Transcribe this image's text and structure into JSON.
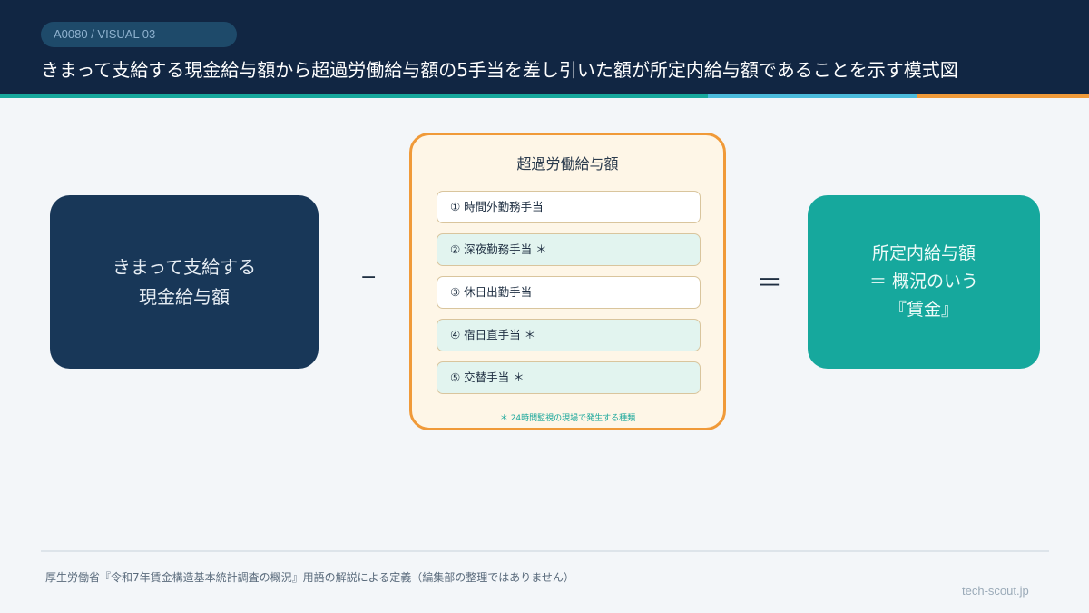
{
  "header": {
    "badge": "A0080 / VISUAL 03",
    "title": "きまって支給する現金給与額から超過労働給与額の5手当を差し引いた額が所定内給与額であることを示す模式図",
    "accent_colors": [
      "#17a89c",
      "#4bbbdc",
      "#f09a39"
    ]
  },
  "left_box": {
    "line1": "きまって支給する",
    "line2": "現金給与額",
    "color": "#183758"
  },
  "operators": {
    "minus": "−",
    "equals": "＝"
  },
  "center_box": {
    "title": "超過労働給与額",
    "allowances": [
      "① 時間外勤務手当",
      "② 深夜勤務手当 ＊",
      "③ 休日出勤手当",
      "④ 宿日直手当 ＊",
      "⑤ 交替手当 ＊"
    ],
    "note": "＊ 24時間監視の現場で発生する種類",
    "border_color": "#f09a39"
  },
  "right_box": {
    "line1": "所定内給与額",
    "line2": "＝ 概況のいう",
    "line3": "『賃金』",
    "color": "#16a89d"
  },
  "footer": {
    "source": "厚生労働省『令和7年賃金構造基本統計調査の概況』用語の解説による定義（編集部の整理ではありません）",
    "credit": "tech-scout.jp"
  }
}
